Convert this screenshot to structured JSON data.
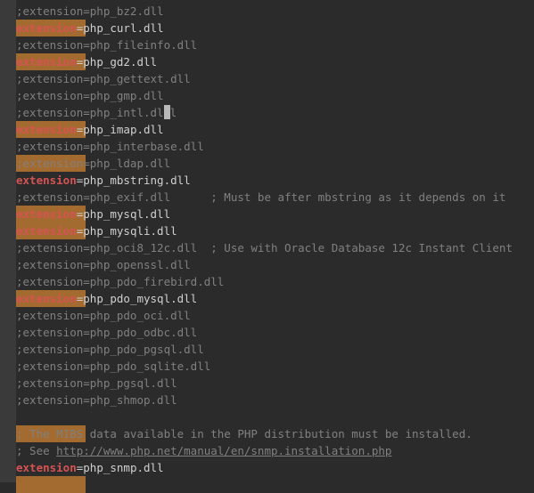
{
  "selection_lines": [
    1,
    3,
    7,
    9,
    12,
    13,
    17,
    25,
    28
  ],
  "lines": [
    {
      "type": "comment",
      "text": ";extension=php_bz2.dll"
    },
    {
      "type": "active",
      "key": "extension",
      "eq": "=",
      "val": "php_curl.dll"
    },
    {
      "type": "comment",
      "text": ";extension=php_fileinfo.dll"
    },
    {
      "type": "active",
      "key": "extension",
      "eq": "=",
      "val": "php_gd2.dll"
    },
    {
      "type": "comment",
      "text": ";extension=php_gettext.dll"
    },
    {
      "type": "comment",
      "text": ";extension=php_gmp.dll"
    },
    {
      "type": "comment_cursor",
      "text": ";extension=php_intl.dl",
      "tail": "l"
    },
    {
      "type": "active",
      "key": "extension",
      "eq": "=",
      "val": "php_imap.dll"
    },
    {
      "type": "comment",
      "text": ";extension=php_interbase.dll"
    },
    {
      "type": "comment",
      "text": ";extension=php_ldap.dll"
    },
    {
      "type": "active",
      "key": "extension",
      "eq": "=",
      "val": "php_mbstring.dll"
    },
    {
      "type": "comment",
      "text": ";extension=php_exif.dll      ; Must be after mbstring as it depends on it"
    },
    {
      "type": "active",
      "key": "extension",
      "eq": "=",
      "val": "php_mysql.dll"
    },
    {
      "type": "active",
      "key": "extension",
      "eq": "=",
      "val": "php_mysqli.dll"
    },
    {
      "type": "comment",
      "text": ";extension=php_oci8_12c.dll  ; Use with Oracle Database 12c Instant Client"
    },
    {
      "type": "comment",
      "text": ";extension=php_openssl.dll"
    },
    {
      "type": "comment",
      "text": ";extension=php_pdo_firebird.dll"
    },
    {
      "type": "active",
      "key": "extension",
      "eq": "=",
      "val": "php_pdo_mysql.dll"
    },
    {
      "type": "comment",
      "text": ";extension=php_pdo_oci.dll"
    },
    {
      "type": "comment",
      "text": ";extension=php_pdo_odbc.dll"
    },
    {
      "type": "comment",
      "text": ";extension=php_pdo_pgsql.dll"
    },
    {
      "type": "comment",
      "text": ";extension=php_pdo_sqlite.dll"
    },
    {
      "type": "comment",
      "text": ";extension=php_pgsql.dll"
    },
    {
      "type": "comment",
      "text": ";extension=php_shmop.dll"
    },
    {
      "type": "blank",
      "text": ""
    },
    {
      "type": "comment",
      "text": "; The MIBS data available in the PHP distribution must be installed. "
    },
    {
      "type": "url_comment",
      "pre": "; See ",
      "url": "http://www.php.net/manual/en/snmp.installation.php"
    },
    {
      "type": "active",
      "key": "extension",
      "eq": "=",
      "val": "php_snmp.dll"
    }
  ]
}
